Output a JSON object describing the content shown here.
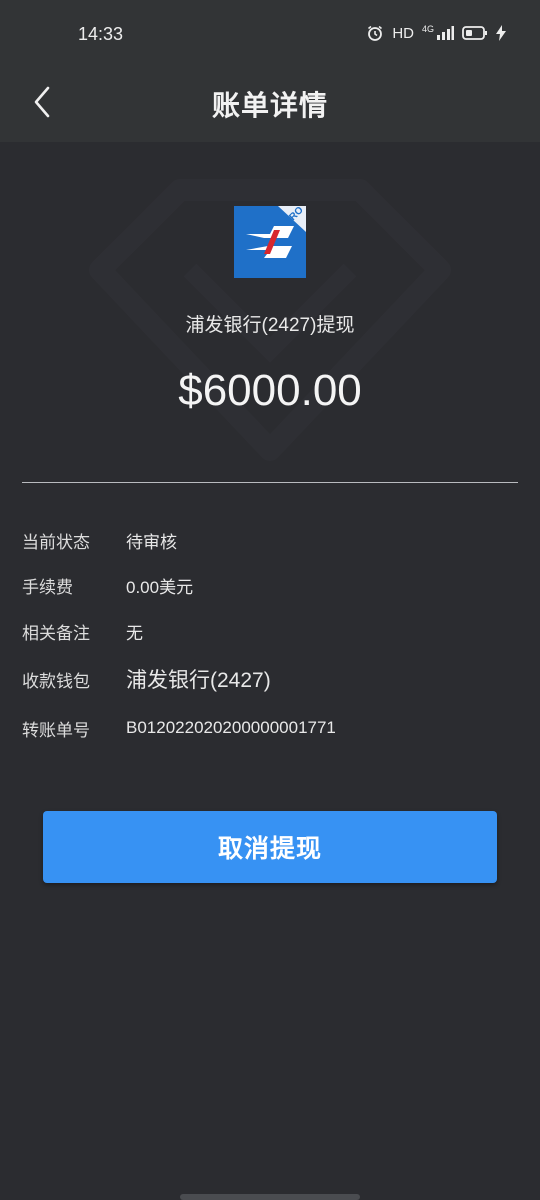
{
  "status_bar": {
    "time": "14:33",
    "hd": "HD",
    "network": "4G",
    "icons": [
      "alarm-icon",
      "signal-icon",
      "battery-icon",
      "charging-icon"
    ]
  },
  "header": {
    "title": "账单详情",
    "back_icon": "chevron-left-icon"
  },
  "summary": {
    "app_icon": "spdb-pro-icon",
    "app_icon_badge": "PRO",
    "description": "浦发银行(2427)提现",
    "amount": "$6000.00"
  },
  "details": {
    "status": {
      "label": "当前状态",
      "value": "待审核"
    },
    "fee": {
      "label": "手续费",
      "value": "0.00美元"
    },
    "remark": {
      "label": "相关备注",
      "value": "无"
    },
    "wallet": {
      "label": "收款钱包",
      "value": "浦发银行(2427)"
    },
    "order_no": {
      "label": "转账单号",
      "value": "B012022020200000001771"
    }
  },
  "actions": {
    "cancel_label": "取消提现"
  },
  "colors": {
    "background": "#2b2c30",
    "header": "#323436",
    "button": "#3792f3",
    "icon_blue": "#1f70c8",
    "icon_red": "#d7282e"
  }
}
